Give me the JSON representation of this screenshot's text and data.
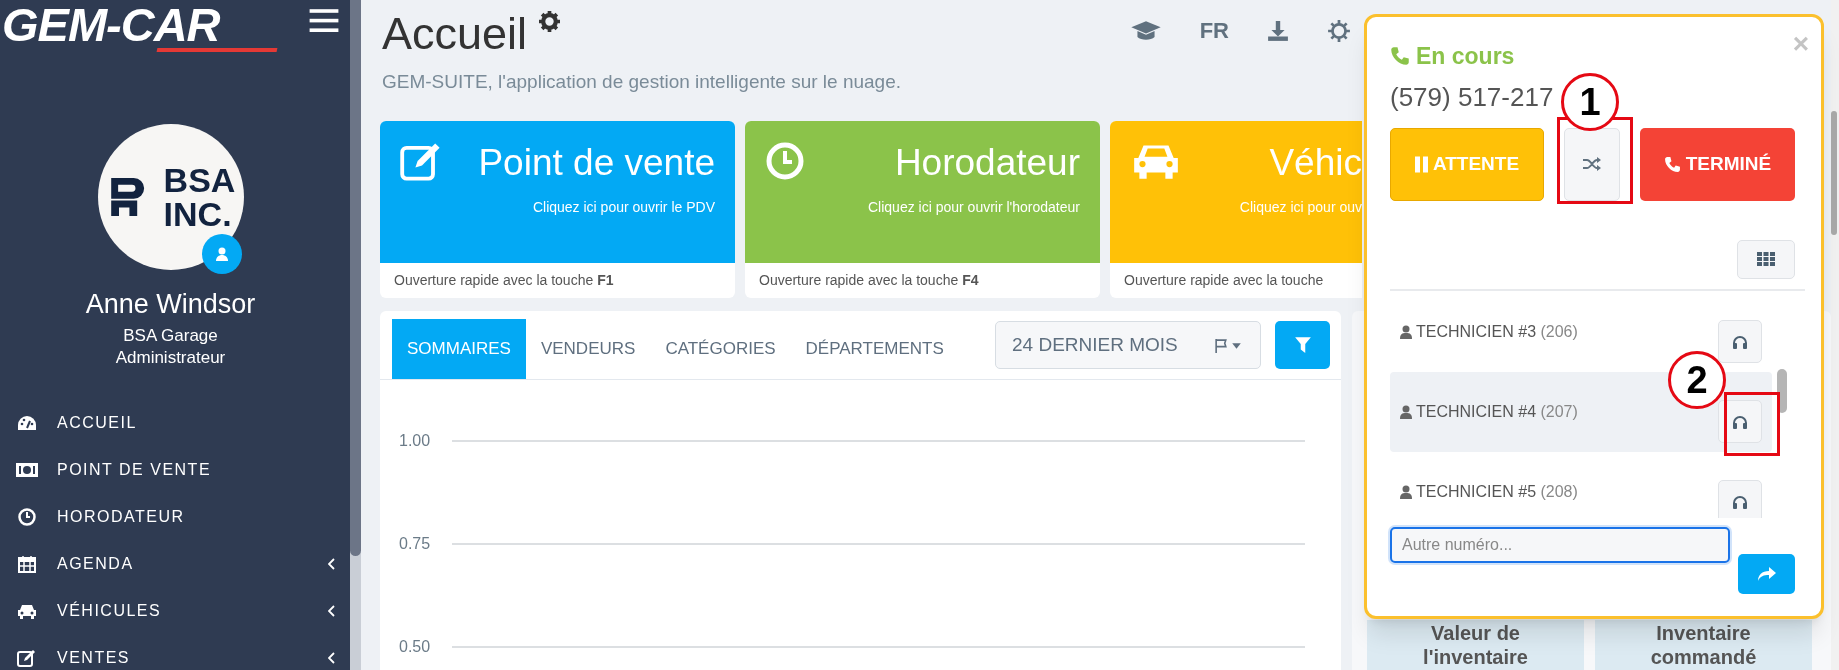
{
  "logo": {
    "text": "GEM-CAR"
  },
  "sidebar": {
    "org_logo": {
      "line_1": "BSA",
      "line_2": "INC."
    },
    "user_name": "Anne Windsor",
    "company": "BSA Garage",
    "role": "Administrateur",
    "items": [
      {
        "label": "ACCUEIL",
        "has_submenu": false
      },
      {
        "label": "POINT DE VENTE",
        "has_submenu": false
      },
      {
        "label": "HORODATEUR",
        "has_submenu": false
      },
      {
        "label": "AGENDA",
        "has_submenu": true
      },
      {
        "label": "VÉHICULES",
        "has_submenu": true
      },
      {
        "label": "VENTES",
        "has_submenu": true
      }
    ]
  },
  "header": {
    "title": "Accueil",
    "subtitle": "GEM-SUITE, l'application de gestion intelligente sur le nuage.",
    "language": "FR"
  },
  "tiles": [
    {
      "title": "Point de vente",
      "subtitle": "Cliquez ici pour ouvrir le PDV",
      "footer": "Ouverture rapide avec la touche **F1**",
      "color": "#03a9f4"
    },
    {
      "title": "Horodateur",
      "subtitle": "Cliquez ici pour ouvrir l'horodateur",
      "footer": "Ouverture rapide avec la touche **F4**",
      "color": "#8bc34a"
    },
    {
      "title": "Véhic",
      "subtitle": "Cliquez ici pour ouv",
      "footer": "Ouverture rapide avec la touche",
      "color": "#ffc107"
    }
  ],
  "tabs": [
    {
      "label": "SOMMAIRES",
      "selected": true
    },
    {
      "label": "VENDEURS",
      "selected": false
    },
    {
      "label": "CATÉGORIES",
      "selected": false
    },
    {
      "label": "DÉPARTEMENTS",
      "selected": false
    }
  ],
  "period": {
    "value": "24 DERNIER MOIS"
  },
  "chart": {
    "gridline_labels": [
      "1.00",
      "0.75",
      "0.50"
    ]
  },
  "stat_cards": [
    {
      "label": "Valeur de l'inventaire"
    },
    {
      "label": "Inventaire commandé"
    }
  ],
  "call_popup": {
    "close": "×",
    "status": "En cours",
    "phone": "(579) 517-217",
    "actions": [
      {
        "kind": "hold",
        "label": "ATTENTE"
      },
      {
        "kind": "transfer"
      },
      {
        "kind": "end",
        "label": "TERMINÉ"
      }
    ],
    "agents": [
      {
        "name": "TECHNICIEN #3",
        "extension": "(206)",
        "selected": false
      },
      {
        "name": "TECHNICIEN #4",
        "extension": "(207)",
        "selected": true
      },
      {
        "name": "TECHNICIEN #5",
        "extension": "(208)",
        "selected": false
      }
    ],
    "other_number": {
      "placeholder": "Autre numéro...",
      "focused": true
    }
  },
  "annotations": [
    {
      "label": "1"
    },
    {
      "label": "2"
    }
  ]
}
